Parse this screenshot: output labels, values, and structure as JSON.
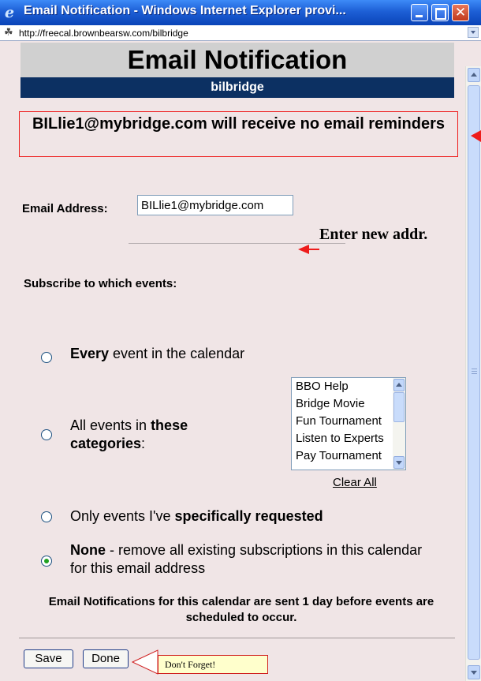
{
  "window": {
    "title": "Email Notification - Windows Internet Explorer provi...",
    "url": "http://freecal.brownbearsw.com/bilbridge",
    "close_glyph": "✕"
  },
  "page": {
    "title": "Email Notification",
    "calendar_name": "bilbridge",
    "notice": "BILlie1@mybridge.com will receive no email reminders",
    "email_label": "Email Address:",
    "email_value": "BILlie1@mybridge.com",
    "subscribe_label": "Subscribe to which events:",
    "options": {
      "every_bold": "Every",
      "every_rest": " event in the calendar",
      "categories_pre": "All events in ",
      "categories_bold1": "these",
      "categories_bold2": "categories",
      "categories_post": ":",
      "specific_pre": "Only events I've ",
      "specific_bold": "specifically requested",
      "none_bold": "None",
      "none_rest": " - remove all existing subscriptions in this calendar for this email address"
    },
    "categories": [
      "BBO Help",
      "Bridge Movie",
      "Fun Tournament",
      "Listen to Experts",
      "Pay Tournament"
    ],
    "clear_all": "Clear All",
    "footnote": "Email Notifications for this calendar are sent 1 day before events are scheduled to occur.",
    "save_button": "Save",
    "done_button": "Done",
    "selected_option": "None"
  },
  "annotations": {
    "enter_new_addr": "Enter new addr.",
    "dont_forget": "Don't Forget!",
    "color": "#ee1c1c"
  }
}
